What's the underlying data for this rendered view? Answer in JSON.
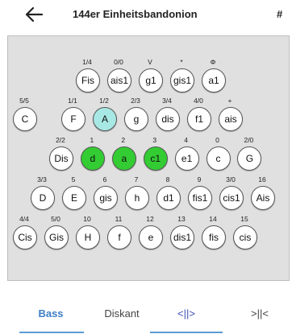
{
  "header": {
    "title": "144er Einheitsbandonion",
    "menu_symbol": "#"
  },
  "colors": {
    "key_default": "#ffffff",
    "key_active": "#33cc33",
    "key_highlight": "#a7e8e4",
    "panel_bg": "#e0e0e0",
    "tab_active": "#3f7fc6"
  },
  "keyboard": {
    "rows": [
      {
        "keys": [
          {
            "note": "Fis",
            "label": "1/4",
            "state": "default"
          },
          {
            "note": "ais1",
            "label": "0/0",
            "state": "default"
          },
          {
            "note": "g1",
            "label": "V",
            "state": "default"
          },
          {
            "note": "gis1",
            "label": "*",
            "state": "default"
          },
          {
            "note": "a1",
            "label": "Φ",
            "state": "default"
          }
        ]
      },
      {
        "keys": [
          {
            "note": "C",
            "label": "5/5",
            "state": "default"
          },
          {
            "note": "F",
            "label": "1/1",
            "state": "default"
          },
          {
            "note": "A",
            "label": "1/2",
            "state": "highlight"
          },
          {
            "note": "g",
            "label": "2/3",
            "state": "default"
          },
          {
            "note": "dis",
            "label": "3/4",
            "state": "default"
          },
          {
            "note": "f1",
            "label": "4/0",
            "state": "default"
          },
          {
            "note": "ais",
            "label": "+",
            "state": "default"
          }
        ]
      },
      {
        "keys": [
          {
            "note": "Dis",
            "label": "2/2",
            "state": "default"
          },
          {
            "note": "d",
            "label": "1",
            "state": "active"
          },
          {
            "note": "a",
            "label": "2",
            "state": "active"
          },
          {
            "note": "c1",
            "label": "3",
            "state": "active"
          },
          {
            "note": "e1",
            "label": "4",
            "state": "default"
          },
          {
            "note": "c",
            "label": "0",
            "state": "default"
          },
          {
            "note": "G",
            "label": "2/0",
            "state": "default"
          }
        ]
      },
      {
        "keys": [
          {
            "note": "D",
            "label": "3/3",
            "state": "default"
          },
          {
            "note": "E",
            "label": "5",
            "state": "default"
          },
          {
            "note": "gis",
            "label": "6",
            "state": "default"
          },
          {
            "note": "h",
            "label": "7",
            "state": "default"
          },
          {
            "note": "d1",
            "label": "8",
            "state": "default"
          },
          {
            "note": "fis1",
            "label": "9",
            "state": "default"
          },
          {
            "note": "cis1",
            "label": "3/0",
            "state": "default"
          },
          {
            "note": "Ais",
            "label": "16",
            "state": "default"
          }
        ]
      },
      {
        "keys": [
          {
            "note": "Cis",
            "label": "4/4",
            "state": "default"
          },
          {
            "note": "Gis",
            "label": "5/0",
            "state": "default"
          },
          {
            "note": "H",
            "label": "10",
            "state": "default"
          },
          {
            "note": "f",
            "label": "11",
            "state": "default"
          },
          {
            "note": "e",
            "label": "12",
            "state": "default"
          },
          {
            "note": "dis1",
            "label": "13",
            "state": "default"
          },
          {
            "note": "fis",
            "label": "14",
            "state": "default"
          },
          {
            "note": "cis",
            "label": "15",
            "state": "default"
          }
        ]
      }
    ]
  },
  "tabs": [
    {
      "label": "Bass",
      "active": true
    },
    {
      "label": "Diskant",
      "active": false
    },
    {
      "label": "<||>",
      "active": true
    },
    {
      "label": ">||<",
      "active": false
    }
  ]
}
